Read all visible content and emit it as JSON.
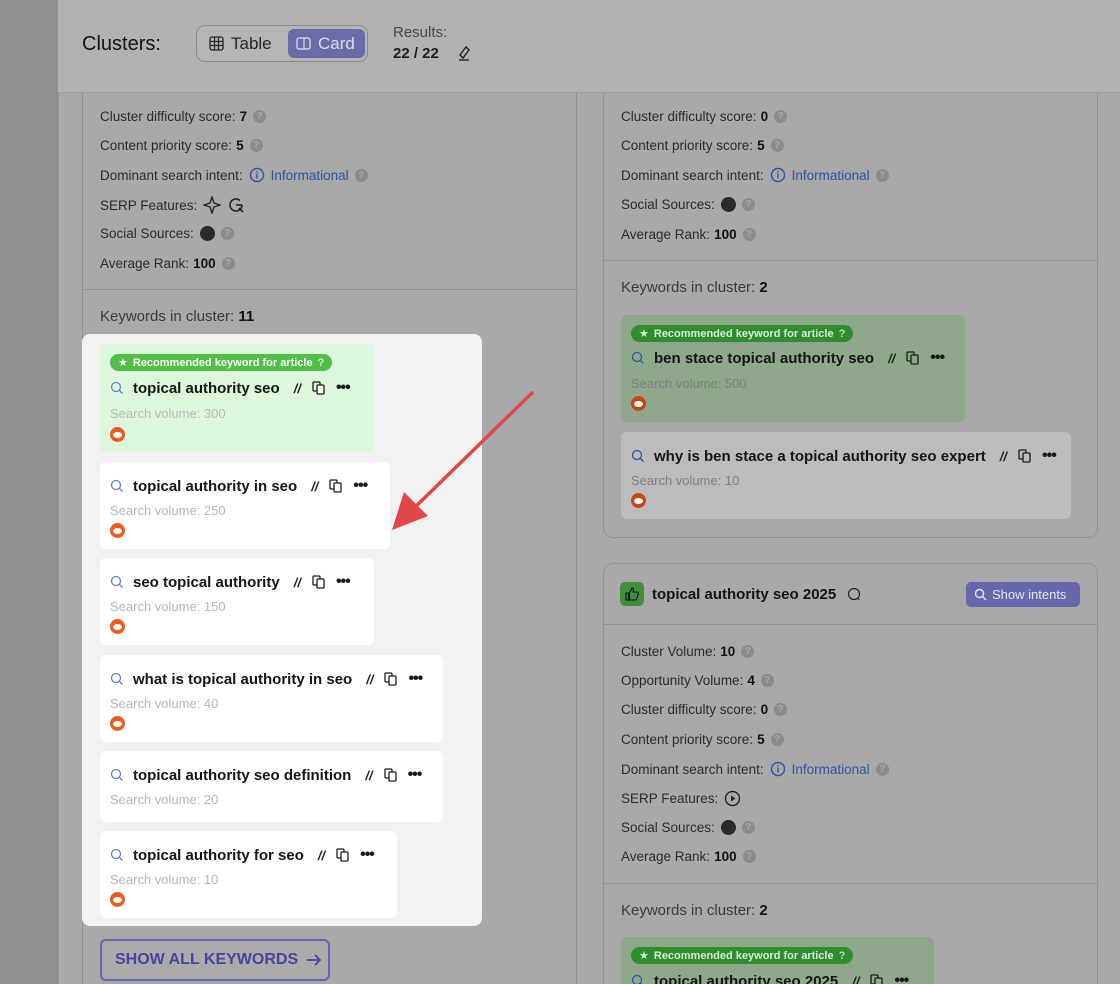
{
  "header": {
    "title": "Clusters:",
    "view_table": "Table",
    "view_card": "Card",
    "results_label": "Results:",
    "results_value": "22 / 22"
  },
  "left_cluster": {
    "difficulty_label": "Cluster difficulty score:",
    "difficulty_value": "7",
    "priority_label": "Content priority score:",
    "priority_value": "5",
    "intent_label": "Dominant search intent:",
    "intent_value": "Informational",
    "serp_label": "SERP Features:",
    "social_label": "Social Sources:",
    "rank_label": "Average Rank:",
    "rank_value": "100",
    "kw_label": "Keywords in cluster:",
    "kw_count": "11",
    "keywords": [
      {
        "badge": "Recommended keyword for article",
        "title": "topical authority seo",
        "volume": "Search volume: 300"
      },
      {
        "title": "topical authority in seo",
        "volume": "Search volume: 250"
      },
      {
        "title": "seo topical authority",
        "volume": "Search volume: 150"
      },
      {
        "title": "what is topical authority in seo",
        "volume": "Search volume: 40"
      },
      {
        "title": "topical authority seo definition",
        "volume": "Search volume: 20"
      },
      {
        "title": "topical authority for seo",
        "volume": "Search volume: 10"
      }
    ],
    "show_all": "SHOW ALL KEYWORDS"
  },
  "right_cluster_1": {
    "difficulty_label": "Cluster difficulty score:",
    "difficulty_value": "0",
    "priority_label": "Content priority score:",
    "priority_value": "5",
    "intent_label": "Dominant search intent:",
    "intent_value": "Informational",
    "social_label": "Social Sources:",
    "rank_label": "Average Rank:",
    "rank_value": "100",
    "kw_label": "Keywords in cluster:",
    "kw_count": "2",
    "keywords": [
      {
        "badge": "Recommended keyword for article",
        "title": "ben stace topical authority seo",
        "volume": "Search volume: 500"
      },
      {
        "title": "why is ben stace a topical authority seo expert",
        "volume": "Search volume: 10"
      }
    ]
  },
  "right_cluster_2": {
    "name": "topical authority seo 2025",
    "show_intents": "Show intents",
    "volume_label": "Cluster Volume:",
    "volume_value": "10",
    "opp_label": "Opportunity Volume:",
    "opp_value": "4",
    "difficulty_label": "Cluster difficulty score:",
    "difficulty_value": "0",
    "priority_label": "Content priority score:",
    "priority_value": "5",
    "intent_label": "Dominant search intent:",
    "intent_value": "Informational",
    "serp_label": "SERP Features:",
    "social_label": "Social Sources:",
    "rank_label": "Average Rank:",
    "rank_value": "100",
    "kw_label": "Keywords in cluster:",
    "kw_count": "2",
    "keywords": [
      {
        "badge": "Recommended keyword for article",
        "title": "topical authority seo 2025"
      }
    ]
  },
  "colors": {
    "accent": "#6b6ba8",
    "arrow": "#e0474a",
    "recommended": "#4fbf48",
    "reddit": "#f05a22"
  }
}
